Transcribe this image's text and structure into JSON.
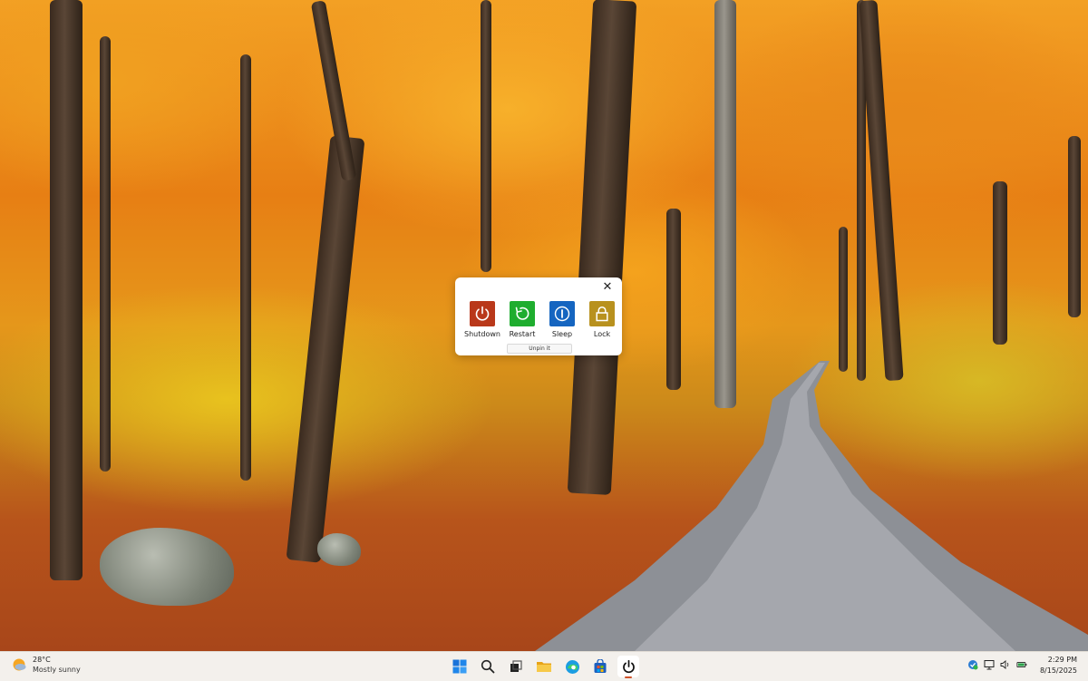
{
  "popup": {
    "close_glyph": "✕",
    "actions": [
      {
        "label": "Shutdown",
        "color": "#b9381a",
        "icon": "power-icon"
      },
      {
        "label": "Restart",
        "color": "#1fad2f",
        "icon": "restart-icon"
      },
      {
        "label": "Sleep",
        "color": "#1565c0",
        "icon": "sleep-icon"
      },
      {
        "label": "Lock",
        "color": "#b8911e",
        "icon": "lock-icon"
      }
    ],
    "unpin_label": "Unpin it"
  },
  "taskbar": {
    "weather": {
      "temp": "28°C",
      "desc": "Mostly sunny",
      "icon": "partly-sunny-icon"
    },
    "apps": [
      {
        "name": "start",
        "icon": "windows-logo-icon"
      },
      {
        "name": "search",
        "icon": "search-icon"
      },
      {
        "name": "task-view",
        "icon": "task-view-icon"
      },
      {
        "name": "file-explorer",
        "icon": "folder-icon"
      },
      {
        "name": "edge",
        "icon": "edge-browser-icon"
      },
      {
        "name": "store",
        "icon": "store-icon"
      },
      {
        "name": "power-app",
        "icon": "power-icon",
        "active": true
      }
    ],
    "tray_icons": [
      "security-icon",
      "network-icon",
      "volume-icon",
      "battery-icon"
    ],
    "clock": {
      "time": "2:29 PM",
      "date": "8/15/2025"
    }
  },
  "colors": {
    "accent": "#d0532b",
    "taskbar_bg": "#f3f0ec"
  }
}
